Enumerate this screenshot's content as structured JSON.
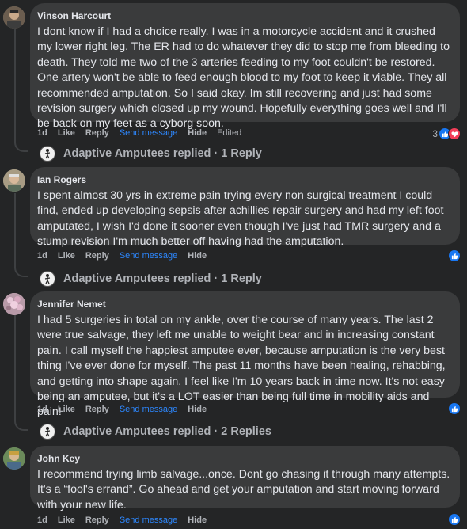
{
  "comments": [
    {
      "author": "Vinson Harcourt",
      "text": "I dont know if I had a choice really. I was in a motorcycle accident and it crushed my lower right leg. The ER had to do whatever they did to stop me from bleeding to death. They told me two of the 3 arteries feeding to my foot couldn't be restored. One artery won't be able to feed enough blood to my foot to keep it viable. They all recommended amputation. So I said okay. Im still recovering and just had some revision surgery which closed up my wound. Hopefully everything goes well and I'll be back on my feet as a cyborg soon.",
      "time": "1d",
      "like": "Like",
      "reply": "Reply",
      "send": "Send message",
      "hide": "Hide",
      "edited": "Edited",
      "reaction_count": "3",
      "replies_label": "Adaptive Amputees replied · 1 Reply"
    },
    {
      "author": "Ian Rogers",
      "text": "I spent almost 30 yrs in extreme pain trying every non surgical treatment I could find, ended up developing sepsis after achillies repair surgery and had my left foot amputated, I wish I'd done it sooner even though I've just had TMR surgery and a stump revision I'm much better off having had the amputation.",
      "time": "1d",
      "like": "Like",
      "reply": "Reply",
      "send": "Send message",
      "hide": "Hide",
      "replies_label": "Adaptive Amputees replied · 1 Reply"
    },
    {
      "author": "Jennifer Nemet",
      "text": "I had 5 surgeries in total on my ankle, over the course of many years. The last 2 were true salvage, they left me unable to weight bear and in increasing constant pain. I call myself the happiest amputee ever, because amputation is the very best thing I've ever done for myself. The past 11 months have been healing, rehabbing, and getting into shape again. I feel like I'm 10 years back in time now. It's not easy being an amputee, but it's a LOT easier than being full time in mobility aids and pain!",
      "time": "1d",
      "like": "Like",
      "reply": "Reply",
      "send": "Send message",
      "hide": "Hide",
      "replies_label": "Adaptive Amputees replied · 2 Replies"
    },
    {
      "author": "John Key",
      "text": "I recommend trying limb salvage...once. Dont go chasing it through many attempts. It's a “fool's errand”. Go ahead and get your amputation and start moving forward with your new life.",
      "time": "1d",
      "like": "Like",
      "reply": "Reply",
      "send": "Send message",
      "hide": "Hide"
    }
  ],
  "icons": {
    "like": "thumbs-up-icon",
    "love": "heart-icon"
  },
  "colors": {
    "background": "#242526",
    "bubble": "#3a3b3c",
    "link": "#2d88ff",
    "like": "#1877f2",
    "love": "#f33e58"
  }
}
